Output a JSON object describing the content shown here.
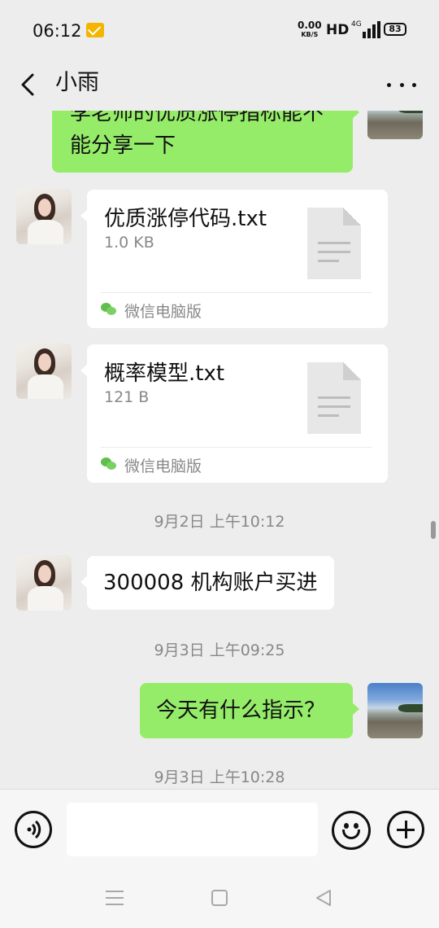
{
  "status_bar": {
    "time": "06:12",
    "net_speed_value": "0.00",
    "net_speed_unit": "KB/S",
    "hd": "HD",
    "network": "4G",
    "battery": "83"
  },
  "header": {
    "title": "小雨",
    "back_icon": "chevron-left-icon",
    "more_icon": "more-horizontal-icon"
  },
  "messages": [
    {
      "type": "text",
      "from": "me",
      "text_line1": "李老师的优质涨停指标能不",
      "text_line2": "能分享一下"
    },
    {
      "type": "file",
      "from": "contact",
      "file_name": "优质涨停代码.txt",
      "file_size": "1.0 KB",
      "source": "微信电脑版"
    },
    {
      "type": "file",
      "from": "contact",
      "file_name": "概率模型.txt",
      "file_size": "121 B",
      "source": "微信电脑版"
    },
    {
      "type": "time",
      "text": "9月2日 上午10:12"
    },
    {
      "type": "text",
      "from": "contact",
      "text": "300008 机构账户买进"
    },
    {
      "type": "time",
      "text": "9月3日 上午09:25"
    },
    {
      "type": "text",
      "from": "me",
      "text": "今天有什么指示？"
    },
    {
      "type": "time",
      "text": "9月3日 上午10:28"
    }
  ],
  "input_bar": {
    "voice_icon": "voice-icon",
    "text_value": "",
    "emoji_icon": "emoji-icon",
    "plus_icon": "plus-icon"
  },
  "colors": {
    "background": "#ededed",
    "my_bubble": "#95ec69",
    "contact_bubble": "#ffffff",
    "timestamp_text": "#888888"
  }
}
